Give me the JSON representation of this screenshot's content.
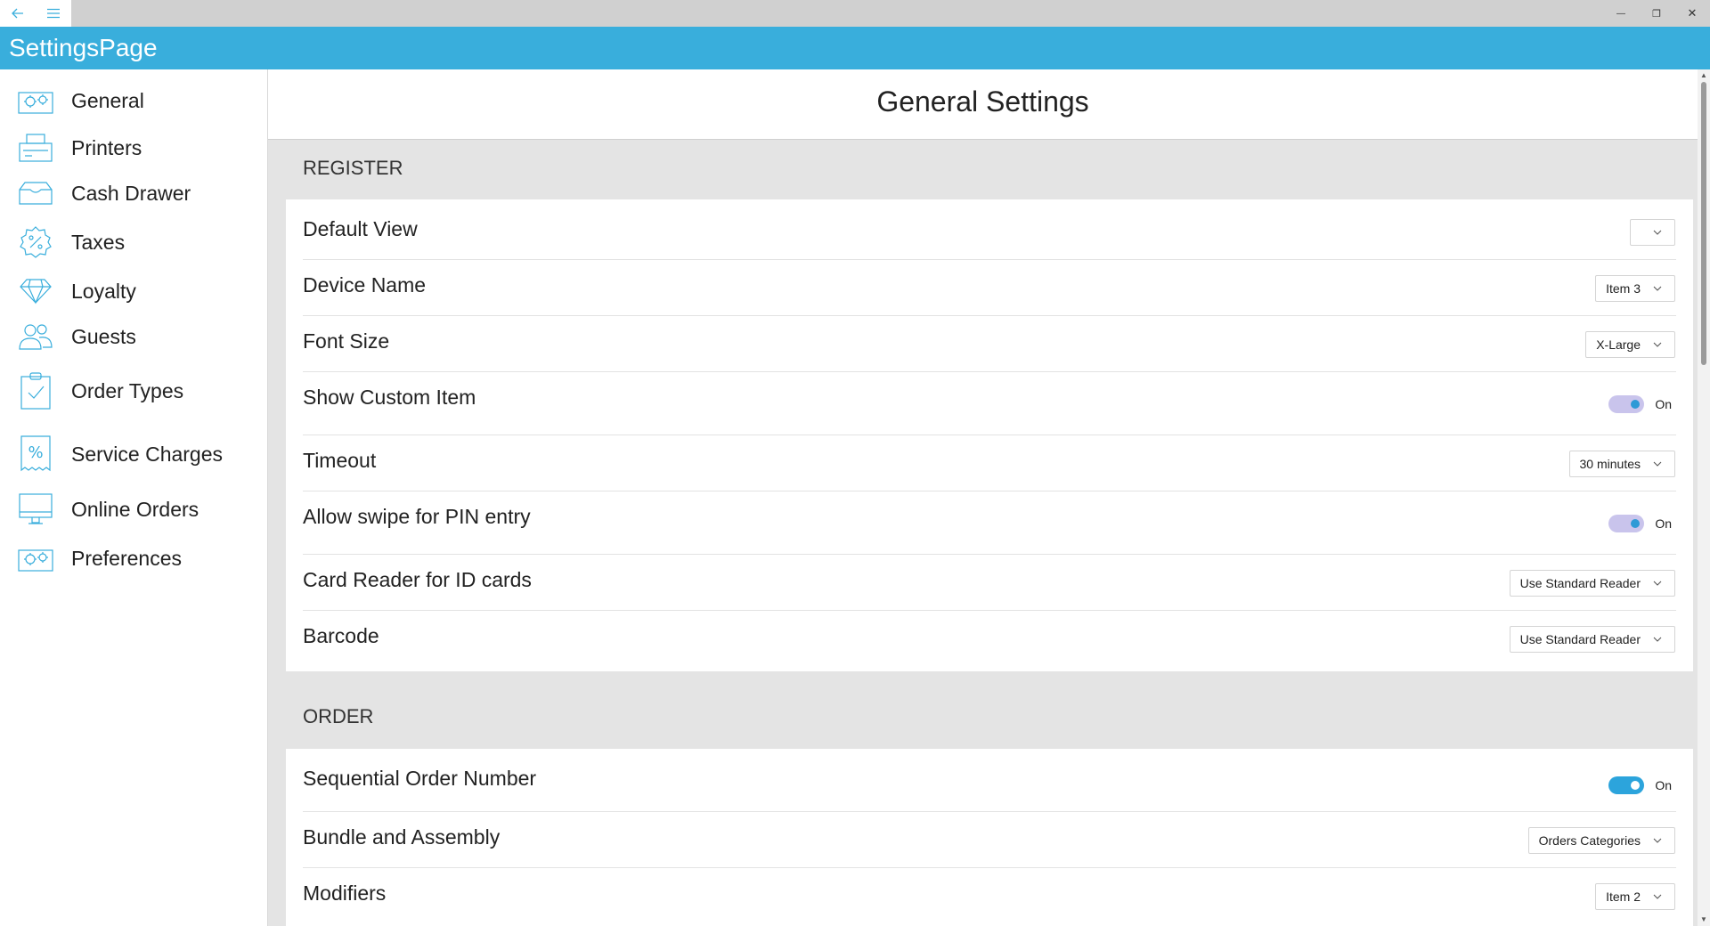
{
  "window": {
    "controls": {
      "minimize": "—",
      "maximize": "❐",
      "close": "✕"
    }
  },
  "app": {
    "title": "SettingsPage"
  },
  "sidebar": {
    "items": [
      {
        "label": "General",
        "icon": "gear-puzzle-icon"
      },
      {
        "label": "Printers",
        "icon": "printer-icon"
      },
      {
        "label": "Cash Drawer",
        "icon": "cash-drawer-icon"
      },
      {
        "label": "Taxes",
        "icon": "percent-badge-icon"
      },
      {
        "label": "Loyalty",
        "icon": "diamond-icon"
      },
      {
        "label": "Guests",
        "icon": "people-icon"
      },
      {
        "label": "Order Types",
        "icon": "clipboard-check-icon"
      },
      {
        "label": "Service Charges",
        "icon": "receipt-percent-icon"
      },
      {
        "label": "Online Orders",
        "icon": "monitor-icon"
      },
      {
        "label": "Preferences",
        "icon": "gear-puzzle-icon"
      }
    ]
  },
  "main": {
    "title": "General Settings",
    "sections": [
      {
        "title": "REGISTER",
        "rows": [
          {
            "label": "Default View",
            "type": "select",
            "value": ""
          },
          {
            "label": "Device Name",
            "type": "select",
            "value": "Item 3"
          },
          {
            "label": "Font Size",
            "type": "select",
            "value": "X-Large"
          },
          {
            "label": "Show Custom Item",
            "type": "toggle",
            "value": "On"
          },
          {
            "label": "Timeout",
            "type": "select",
            "value": "30 minutes"
          },
          {
            "label": "Allow swipe for PIN entry",
            "type": "toggle",
            "value": "On"
          },
          {
            "label": "Card Reader for ID cards",
            "type": "select",
            "value": "Use Standard Reader"
          },
          {
            "label": "Barcode",
            "type": "select",
            "value": "Use Standard Reader"
          }
        ]
      },
      {
        "title": "ORDER",
        "rows": [
          {
            "label": "Sequential Order Number",
            "type": "toggle",
            "value": "On"
          },
          {
            "label": "Bundle and Assembly",
            "type": "select",
            "value": "Orders Categories"
          },
          {
            "label": "Modifiers",
            "type": "select",
            "value": "Item 2"
          }
        ]
      }
    ]
  },
  "colors": {
    "accent": "#39aedc",
    "toggle_on": "#2ca4dc",
    "toggle_soft": "#c9c4ec",
    "section_bg": "#e4e4e4"
  }
}
